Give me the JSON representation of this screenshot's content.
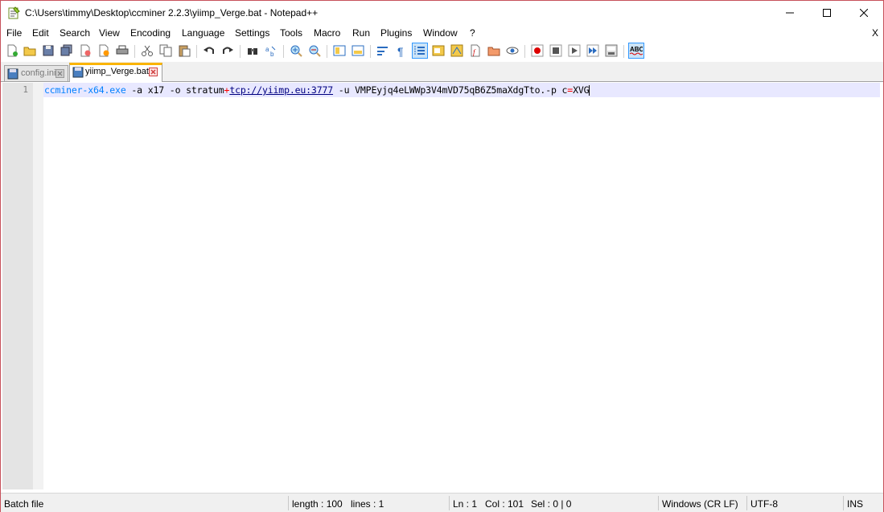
{
  "window": {
    "title": "C:\\Users\\timmy\\Desktop\\ccminer 2.2.3\\yiimp_Verge.bat - Notepad++",
    "controls": [
      "minimize",
      "maximize",
      "close"
    ]
  },
  "menu": {
    "items": [
      "File",
      "Edit",
      "Search",
      "View",
      "Encoding",
      "Language",
      "Settings",
      "Tools",
      "Macro",
      "Run",
      "Plugins",
      "Window",
      "?"
    ],
    "close_label": "X"
  },
  "toolbar": {
    "icons": [
      "new-file-icon",
      "open-file-icon",
      "save-icon",
      "save-all-icon",
      "close-icon",
      "close-all-icon",
      "print-icon",
      "cut-icon",
      "copy-icon",
      "paste-icon",
      "undo-icon",
      "redo-icon",
      "find-icon",
      "replace-icon",
      "zoom-in-icon",
      "zoom-out-icon",
      "sync-vertical-icon",
      "sync-horizontal-icon",
      "word-wrap-icon",
      "show-all-chars-icon",
      "indent-guide-icon",
      "document-map-icon",
      "function-list-icon",
      "doc-list-icon",
      "folder-workspace-icon",
      "monitoring-icon",
      "record-macro-icon",
      "stop-record-icon",
      "play-macro-icon",
      "run-macro-multiple-icon",
      "save-macro-icon",
      "spell-check-icon"
    ],
    "spell_label": "ABC"
  },
  "tabs": [
    {
      "label": "config.ini",
      "active": false
    },
    {
      "label": "yiimp_Verge.bat",
      "active": true
    }
  ],
  "editor": {
    "line_number": "1",
    "tokens": {
      "cmd": "ccminer-x64.exe",
      "part1": " -a x17 -o stratum",
      "plus": "+",
      "url": "tcp://yiimp.eu:3777",
      "part2": " -u VMPEyjq4eLWWp3V4mVD75qB6Z5maXdgTto.-p c",
      "eq": "=",
      "part3": "XVG"
    }
  },
  "status": {
    "file_type": "Batch file",
    "length": "length : 100",
    "lines": "lines : 1",
    "ln": "Ln : 1",
    "col": "Col : 101",
    "sel": "Sel : 0 | 0",
    "eol": "Windows (CR LF)",
    "encoding": "UTF-8",
    "mode": "INS"
  },
  "colors": {
    "window_border": "#c7515b",
    "tab_active_accent": "#fab400",
    "command": "#0080ff",
    "operator": "#ff0000",
    "current_line": "#e8e8ff"
  }
}
